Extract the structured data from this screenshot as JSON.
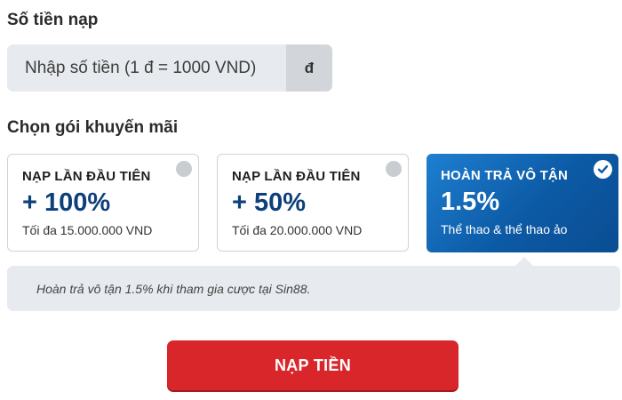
{
  "amount_section": {
    "title": "Số tiền nạp",
    "input_placeholder": "Nhập số tiền (1 đ = 1000 VND)",
    "input_value": "",
    "currency_symbol": "đ"
  },
  "promo_section": {
    "title": "Chọn gói khuyến mãi",
    "packages": [
      {
        "title": "NẠP LẦN ĐẦU TIÊN",
        "value": "+ 100%",
        "note": "Tối đa 15.000.000 VND",
        "selected": false
      },
      {
        "title": "NẠP LẦN ĐẦU TIÊN",
        "value": "+ 50%",
        "note": "Tối đa 20.000.000 VND",
        "selected": false
      },
      {
        "title": "HOÀN TRẢ VÔ TẬN",
        "value": "1.5%",
        "note": "Thể thao & thể thao ảo",
        "selected": true
      }
    ],
    "selected_info": "Hoàn trả vô tận 1.5% khi tham gia cược tại Sin88."
  },
  "submit_label": "NẠP TIỀN",
  "colors": {
    "accent_blue": "#0c5aa5",
    "value_navy": "#0d3f7a",
    "submit_red": "#d8262b",
    "field_gray": "#e7eaee"
  },
  "icons": {
    "unselected": "radio-unselected-icon",
    "selected": "check-circle-icon"
  }
}
